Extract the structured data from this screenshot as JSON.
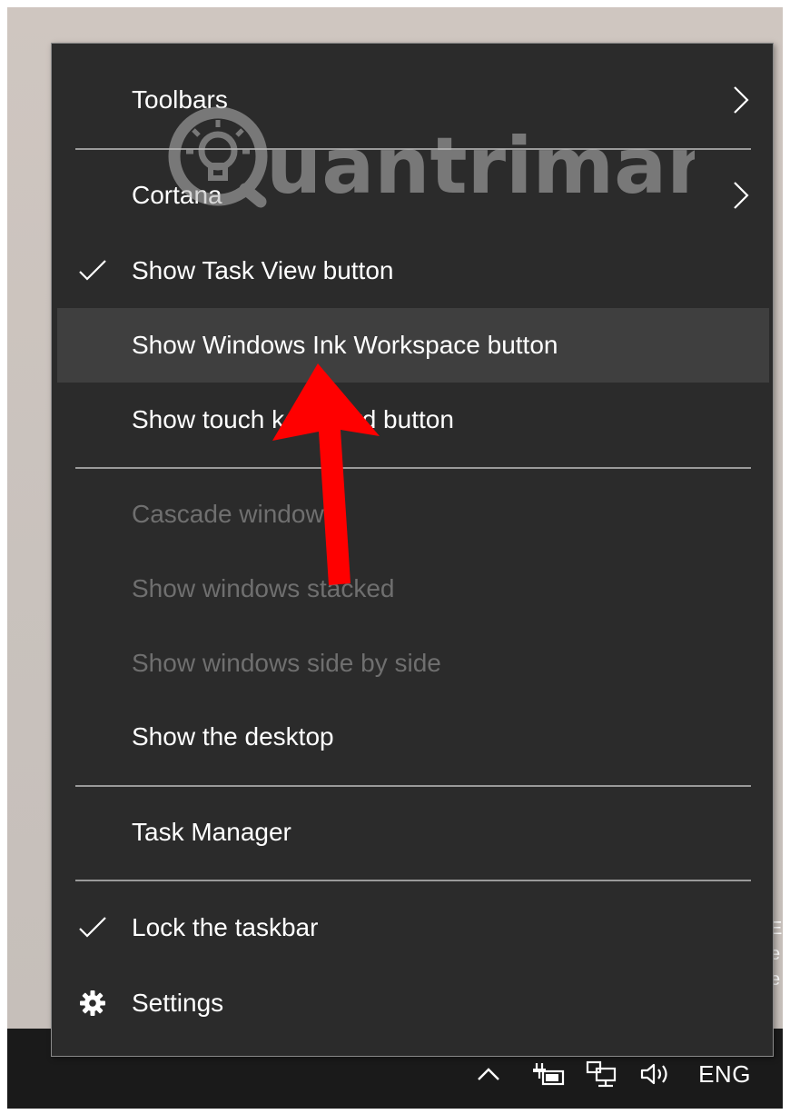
{
  "menu": {
    "items": [
      {
        "label": "Toolbars",
        "checked": false,
        "submenu": true,
        "enabled": true
      },
      {
        "label": "Cortana",
        "checked": false,
        "submenu": true,
        "enabled": true
      },
      {
        "label": "Show Task View button",
        "checked": true,
        "submenu": false,
        "enabled": true
      },
      {
        "label": "Show Windows Ink Workspace button",
        "checked": false,
        "submenu": false,
        "enabled": true,
        "highlighted": true
      },
      {
        "label": "Show touch keyboard button",
        "checked": false,
        "submenu": false,
        "enabled": true
      },
      {
        "label": "Cascade windows",
        "checked": false,
        "submenu": false,
        "enabled": false
      },
      {
        "label": "Show windows stacked",
        "checked": false,
        "submenu": false,
        "enabled": false
      },
      {
        "label": "Show windows side by side",
        "checked": false,
        "submenu": false,
        "enabled": false
      },
      {
        "label": "Show the desktop",
        "checked": false,
        "submenu": false,
        "enabled": true
      },
      {
        "label": "Task Manager",
        "checked": false,
        "submenu": false,
        "enabled": true
      },
      {
        "label": "Lock the taskbar",
        "checked": true,
        "submenu": false,
        "enabled": true
      },
      {
        "label": "Settings",
        "checked": false,
        "submenu": false,
        "enabled": true,
        "icon": "gear-icon"
      }
    ]
  },
  "taskbar": {
    "language": "ENG",
    "tray_icons": [
      "chevron-up-icon",
      "battery-icon",
      "network-icon",
      "volume-icon"
    ]
  },
  "watermark": {
    "text": "uantrimang"
  },
  "colors": {
    "menu_background": "#2b2b2b",
    "highlight": "#3f3f3f",
    "disabled_text": "#6f6f6f",
    "arrow": "#ff0000"
  }
}
